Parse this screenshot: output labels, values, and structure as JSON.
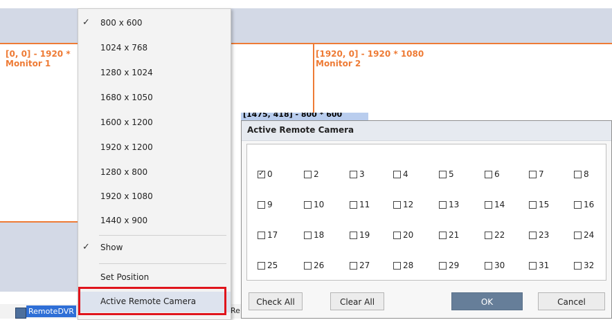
{
  "desktop": {
    "monitors": [
      {
        "coords": "[0, 0] - 1920 *",
        "name": "Monitor 1"
      },
      {
        "coords": "[1920, 0] - 1920 * 1080",
        "name": "Monitor 2"
      }
    ],
    "window_tag": "[1475, 418] - 800 * 600"
  },
  "taskbar": {
    "app_label": "RemoteDVR",
    "trailing_text": "Re"
  },
  "context_menu": {
    "resolutions": [
      {
        "label": "800 x 600",
        "checked": true
      },
      {
        "label": "1024 x 768",
        "checked": false
      },
      {
        "label": "1280 x 1024",
        "checked": false
      },
      {
        "label": "1680 x 1050",
        "checked": false
      },
      {
        "label": "1600 x 1200",
        "checked": false
      },
      {
        "label": "1920 x 1200",
        "checked": false
      },
      {
        "label": "1280 x 800",
        "checked": false
      },
      {
        "label": "1920 x 1080",
        "checked": false
      },
      {
        "label": "1440 x 900",
        "checked": false
      }
    ],
    "show_label": "Show",
    "show_checked": true,
    "set_position_label": "Set Position",
    "active_remote_camera_label": "Active Remote Camera",
    "check_glyph": "✓"
  },
  "dialog": {
    "title": "Active Remote Camera",
    "cameras": [
      {
        "num": "0",
        "checked": true
      },
      {
        "num": "2",
        "checked": false
      },
      {
        "num": "3",
        "checked": false
      },
      {
        "num": "4",
        "checked": false
      },
      {
        "num": "5",
        "checked": false
      },
      {
        "num": "6",
        "checked": false
      },
      {
        "num": "7",
        "checked": false
      },
      {
        "num": "8",
        "checked": false
      },
      {
        "num": "9",
        "checked": false
      },
      {
        "num": "10",
        "checked": false
      },
      {
        "num": "11",
        "checked": false
      },
      {
        "num": "12",
        "checked": false
      },
      {
        "num": "13",
        "checked": false
      },
      {
        "num": "14",
        "checked": false
      },
      {
        "num": "15",
        "checked": false
      },
      {
        "num": "16",
        "checked": false
      },
      {
        "num": "17",
        "checked": false
      },
      {
        "num": "18",
        "checked": false
      },
      {
        "num": "19",
        "checked": false
      },
      {
        "num": "20",
        "checked": false
      },
      {
        "num": "21",
        "checked": false
      },
      {
        "num": "22",
        "checked": false
      },
      {
        "num": "23",
        "checked": false
      },
      {
        "num": "24",
        "checked": false
      },
      {
        "num": "25",
        "checked": false
      },
      {
        "num": "26",
        "checked": false
      },
      {
        "num": "27",
        "checked": false
      },
      {
        "num": "28",
        "checked": false
      },
      {
        "num": "29",
        "checked": false
      },
      {
        "num": "30",
        "checked": false
      },
      {
        "num": "31",
        "checked": false
      },
      {
        "num": "32",
        "checked": false
      }
    ],
    "buttons": {
      "check_all": "Check All",
      "clear_all": "Clear All",
      "ok": "OK",
      "cancel": "Cancel"
    }
  },
  "colors": {
    "monitor_accent": "#ee7b35",
    "highlight": "#e0141c",
    "ok_button": "#667e99"
  }
}
